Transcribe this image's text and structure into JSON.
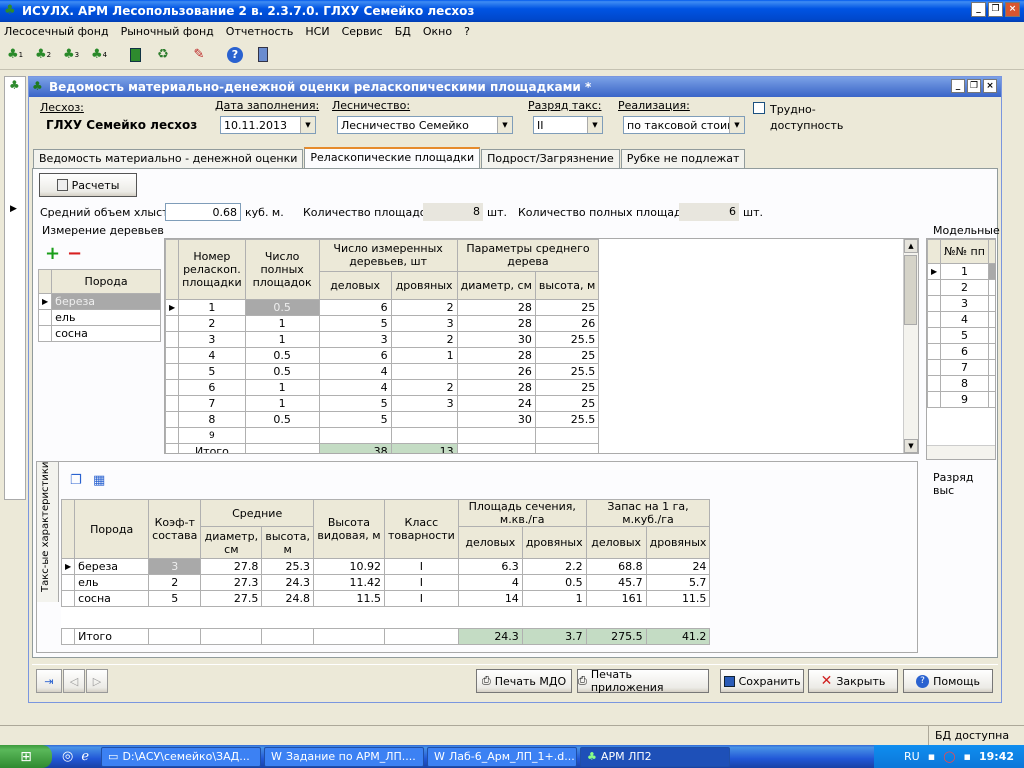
{
  "window": {
    "title": "ИСУЛХ. АРМ Лесопользование 2 в. 2.3.7.0. ГЛХУ Семейко лесхоз",
    "min": "_",
    "restore": "❐",
    "close": "×"
  },
  "menu": [
    "Лесосечный фонд",
    "Рыночный фонд",
    "Отчетность",
    "НСИ",
    "Сервис",
    "БД",
    "Окно",
    "?"
  ],
  "toolbar_icons": [
    "tree-a1-icon",
    "tree-a2-icon",
    "tree-a3-icon",
    "tree-a4-icon",
    "book-icon",
    "recycle-icon",
    "edit-icon",
    "help-icon",
    "door-icon"
  ],
  "toolbar_icon_labels": [
    "1",
    "2",
    "3",
    "4"
  ],
  "doc": {
    "title": "Ведомость материально-денежной оценки реласкопическими площадками *",
    "leshoz_label": "Лесхоз:",
    "leshoz_value": "ГЛХУ Семейко лесхоз",
    "date_label": "Дата заполнения:",
    "date_value": "10.11.2013",
    "lesn_label": "Лесничество:",
    "lesn_value": "Лесничество Семейко",
    "razr_label": "Разряд такс:",
    "razr_value": "II",
    "real_label": "Реализация:",
    "real_value": "по таксовой стоимо",
    "trud_label1": "Трудно-",
    "trud_label2": "доступность"
  },
  "tabs": [
    "Ведомость материально - денежной оценки",
    "Реласкопические площадки",
    "Подрост/Загрязнение",
    "Рубке не подлежат"
  ],
  "calc_button": "Расчеты",
  "avg_vol_label": "Средний объем хлыста:",
  "avg_vol_value": "0.68",
  "avg_vol_unit": "куб. м.",
  "count_label": "Количество площадок:",
  "count_value": "8",
  "count_unit": "шт.",
  "full_label": "Количество полных площадок:",
  "full_value": "6",
  "full_unit": "шт.",
  "measure_title": "Измерение деревьев",
  "species_header": "Порода",
  "species": [
    "береза",
    "ель",
    "сосна"
  ],
  "plots_headers": {
    "num": "Номер реласкоп. площадки",
    "full": "Число полных площадок",
    "measured": "Число измеренных деревьев, шт",
    "params": "Параметры среднего дерева",
    "del": "деловых",
    "drov": "дровяных",
    "diam": "диаметр, см",
    "height": "высота, м"
  },
  "plots_rows": [
    [
      "1",
      "0.5",
      "6",
      "2",
      "28",
      "25"
    ],
    [
      "2",
      "1",
      "5",
      "3",
      "28",
      "26"
    ],
    [
      "3",
      "1",
      "3",
      "2",
      "30",
      "25.5"
    ],
    [
      "4",
      "0.5",
      "6",
      "1",
      "28",
      "25"
    ],
    [
      "5",
      "0.5",
      "4",
      "",
      "26",
      "25.5"
    ],
    [
      "6",
      "1",
      "4",
      "2",
      "28",
      "25"
    ],
    [
      "7",
      "1",
      "5",
      "3",
      "24",
      "25"
    ],
    [
      "8",
      "0.5",
      "5",
      "",
      "30",
      "25.5"
    ],
    [
      "9",
      "",
      "",
      "",
      "",
      ""
    ]
  ],
  "plots_total": {
    "label": "Итого",
    "del": "38",
    "drov": "13"
  },
  "model_title": "Модельные",
  "model_header": "№№ пп",
  "model_rows": [
    "1",
    "2",
    "3",
    "4",
    "5",
    "6",
    "7",
    "8",
    "9"
  ],
  "razr_vys": "Разряд выс",
  "side_tab": "Такс-ые характеристики",
  "tax_headers": {
    "species": "Порода",
    "coef": "Коэф-т состава",
    "avg": "Средние",
    "diam": "диаметр, см",
    "height": "высота, м",
    "vh": "Высота видовая, м",
    "class": "Класс товарности",
    "area": "Площадь сечения, м.кв./га",
    "stock": "Запас на 1 га, м.куб./га",
    "del": "деловых",
    "drov": "дровяных"
  },
  "tax_rows": [
    [
      "береза",
      "3",
      "27.8",
      "25.3",
      "10.92",
      "I",
      "6.3",
      "2.2",
      "68.8",
      "24"
    ],
    [
      "ель",
      "2",
      "27.3",
      "24.3",
      "11.42",
      "I",
      "4",
      "0.5",
      "45.7",
      "5.7"
    ],
    [
      "сосна",
      "5",
      "27.5",
      "24.8",
      "11.5",
      "I",
      "14",
      "1",
      "161",
      "11.5"
    ]
  ],
  "tax_total": {
    "label": "Итого",
    "a1": "24.3",
    "a2": "3.7",
    "s1": "275.5",
    "s2": "41.2"
  },
  "buttons": {
    "print_mdo": "Печать МДО",
    "print_app": "Печать приложения",
    "save": "Сохранить",
    "close": "Закрыть",
    "help": "Помощь"
  },
  "status": "БД доступна",
  "taskbar": {
    "items": [
      "D:\\АСУ\\семейко\\ЗАД...",
      "Задание по АРМ_ЛП....",
      "Лаб-6_Арм_ЛП_1+.d...",
      "АРМ ЛП2"
    ],
    "lang": "RU",
    "time": "19:42"
  },
  "colors": {
    "accent_green": "#c4dcc4",
    "title_blue": "#0054e3",
    "selected_grey": "#a9a9a9"
  }
}
